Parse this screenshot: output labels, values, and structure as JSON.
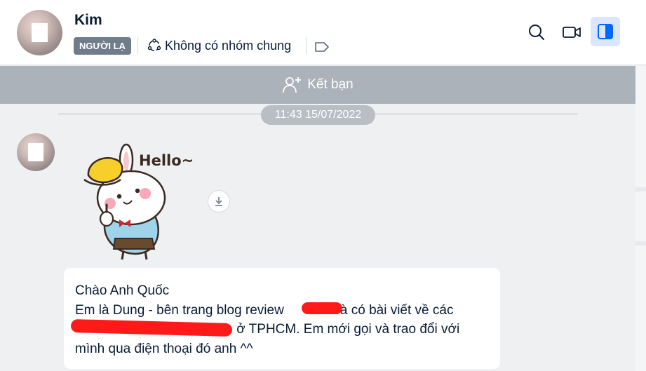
{
  "header": {
    "name": "Kim",
    "badge": "NGƯỜI LẠ",
    "group_info": "Không có nhóm chung",
    "icons": {
      "group": "group-circle-icon",
      "tag": "tag-icon",
      "search": "search-icon",
      "video": "video-call-icon",
      "panel": "side-panel-icon"
    }
  },
  "add_friend": {
    "label": "Kết bạn",
    "icon": "add-user-icon"
  },
  "conversation": {
    "timestamp": "11:43 15/07/2022",
    "sticker": {
      "text": "Hello~",
      "download_icon": "download-icon"
    },
    "message_lines": [
      "Chào Anh Quốc",
      "Em là Dung - bên trang blog review",
      "và có bài viết về các",
      "ở TPHCM. Em mới gọi và trao đổi với",
      "mình qua điện thoại đó anh ^^"
    ]
  },
  "colors": {
    "badge": "#6f7c8b",
    "add_friend_bar": "#abb2ba",
    "panel_button_bg": "#dbe6fb",
    "panel_button_icon": "#0068ff",
    "redaction": "#ff1a1a"
  }
}
